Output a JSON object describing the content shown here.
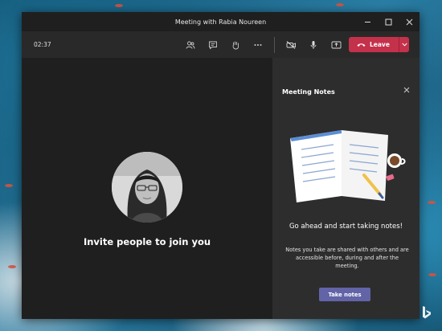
{
  "window": {
    "title": "Meeting with Rabia Noureen"
  },
  "toolbar": {
    "timer": "02:37",
    "leave_label": "Leave",
    "icons": [
      "people-icon",
      "chat-icon",
      "raise-hand-icon",
      "more-icon",
      "camera-off-icon",
      "microphone-icon",
      "share-screen-icon"
    ]
  },
  "stage": {
    "invite_text": "Invite people to join you"
  },
  "notes_panel": {
    "title": "Meeting Notes",
    "headline": "Go ahead and start taking notes!",
    "description": "Notes you take are shared with others and are accessible before, during and after the meeting.",
    "button_label": "Take notes"
  },
  "colors": {
    "leave": "#c4314b",
    "accent": "#6264a7",
    "panel": "#2d2d2d",
    "stage": "#1f1f1f"
  }
}
